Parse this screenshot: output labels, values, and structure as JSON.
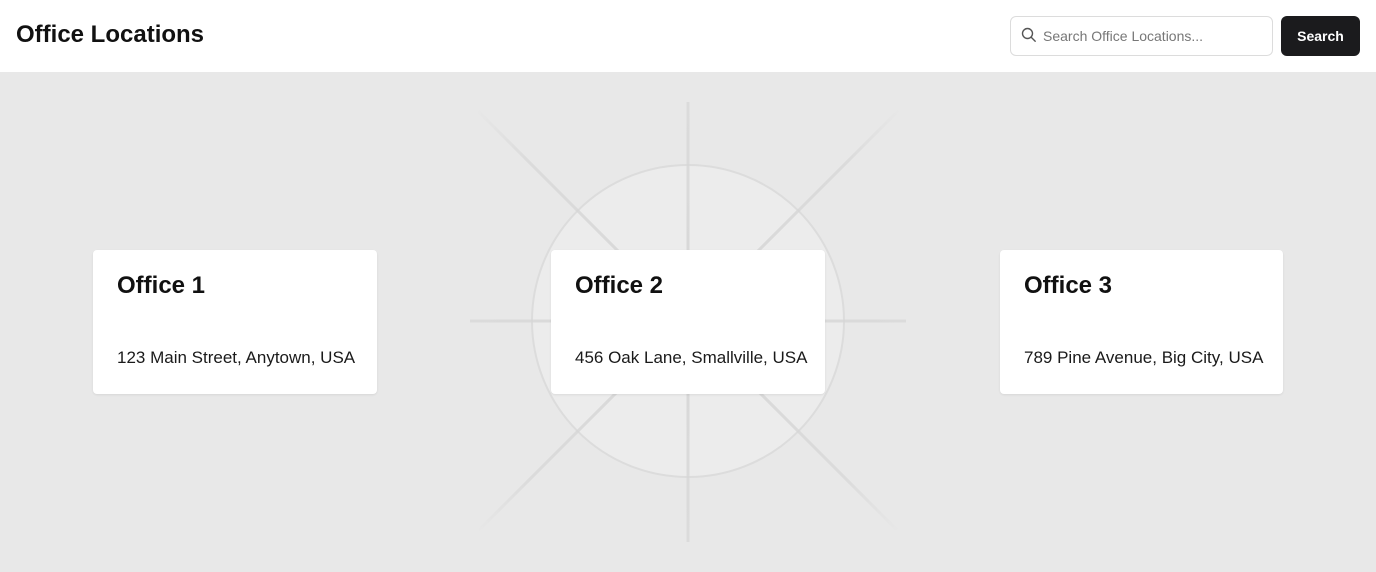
{
  "header": {
    "title": "Office Locations",
    "search": {
      "placeholder": "Search Office Locations...",
      "value": "",
      "icon": "search-icon"
    },
    "search_button_label": "Search"
  },
  "offices": [
    {
      "name": "Office 1",
      "address": "123 Main Street, Anytown, USA"
    },
    {
      "name": "Office 2",
      "address": "456 Oak Lane, Smallville, USA"
    },
    {
      "name": "Office 3",
      "address": "789 Pine Avenue, Big City, USA"
    }
  ],
  "colors": {
    "background": "#e8e8e8",
    "card": "#ffffff",
    "button": "#1b1b1d",
    "button_text": "#ffffff",
    "text": "#111111"
  }
}
